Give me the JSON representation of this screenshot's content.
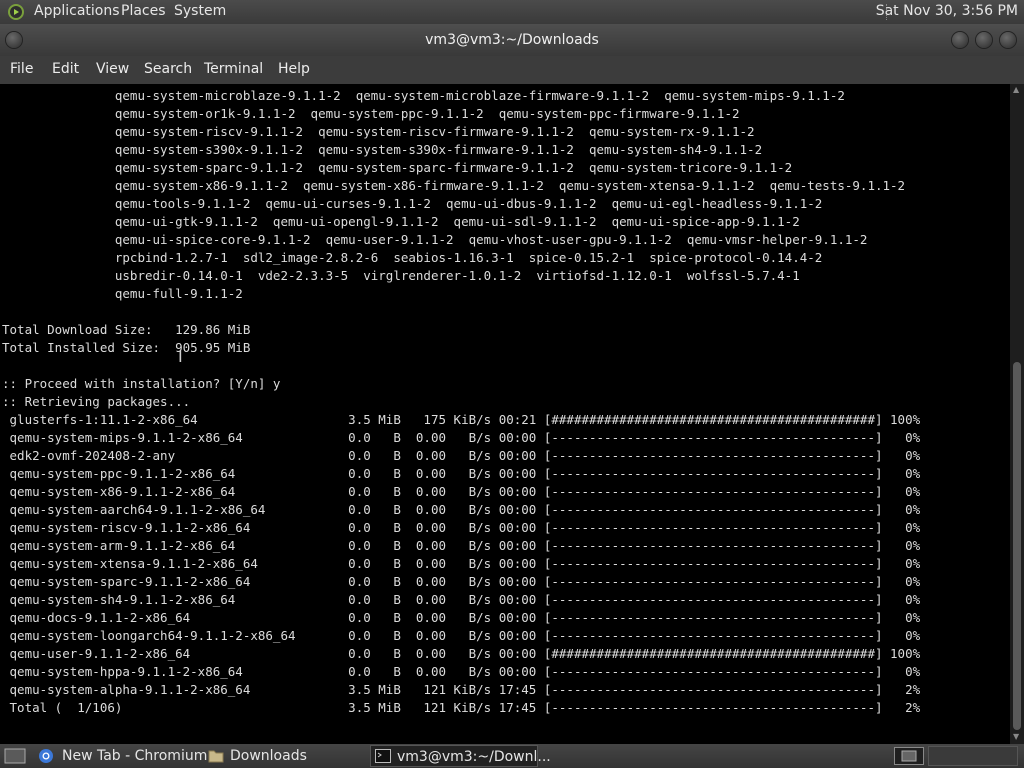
{
  "top_panel": {
    "menus": [
      "Applications",
      "Places",
      "System"
    ],
    "clock": "Sat Nov 30,  3:56 PM"
  },
  "window": {
    "title": "vm3@vm3:~/Downloads",
    "menu": [
      "File",
      "Edit",
      "View",
      "Search",
      "Terminal",
      "Help"
    ]
  },
  "terminal_lines": [
    "               qemu-system-microblaze-9.1.1-2  qemu-system-microblaze-firmware-9.1.1-2  qemu-system-mips-9.1.1-2",
    "               qemu-system-or1k-9.1.1-2  qemu-system-ppc-9.1.1-2  qemu-system-ppc-firmware-9.1.1-2",
    "               qemu-system-riscv-9.1.1-2  qemu-system-riscv-firmware-9.1.1-2  qemu-system-rx-9.1.1-2",
    "               qemu-system-s390x-9.1.1-2  qemu-system-s390x-firmware-9.1.1-2  qemu-system-sh4-9.1.1-2",
    "               qemu-system-sparc-9.1.1-2  qemu-system-sparc-firmware-9.1.1-2  qemu-system-tricore-9.1.1-2",
    "               qemu-system-x86-9.1.1-2  qemu-system-x86-firmware-9.1.1-2  qemu-system-xtensa-9.1.1-2  qemu-tests-9.1.1-2",
    "               qemu-tools-9.1.1-2  qemu-ui-curses-9.1.1-2  qemu-ui-dbus-9.1.1-2  qemu-ui-egl-headless-9.1.1-2",
    "               qemu-ui-gtk-9.1.1-2  qemu-ui-opengl-9.1.1-2  qemu-ui-sdl-9.1.1-2  qemu-ui-spice-app-9.1.1-2",
    "               qemu-ui-spice-core-9.1.1-2  qemu-user-9.1.1-2  qemu-vhost-user-gpu-9.1.1-2  qemu-vmsr-helper-9.1.1-2",
    "               rpcbind-1.2.7-1  sdl2_image-2.8.2-6  seabios-1.16.3-1  spice-0.15.2-1  spice-protocol-0.14.4-2",
    "               usbredir-0.14.0-1  vde2-2.3.3-5  virglrenderer-1.0.1-2  virtiofsd-1.12.0-1  wolfssl-5.7.4-1",
    "               qemu-full-9.1.1-2",
    "",
    "Total Download Size:   129.86 MiB",
    "Total Installed Size:  905.95 MiB",
    "",
    ":: Proceed with installation? [Y/n] y",
    ":: Retrieving packages...",
    " glusterfs-1:11.1-2-x86_64                    3.5 MiB   175 KiB/s 00:21 [###########################################] 100%",
    " qemu-system-mips-9.1.1-2-x86_64              0.0   B  0.00   B/s 00:00 [-------------------------------------------]   0%",
    " edk2-ovmf-202408-2-any                       0.0   B  0.00   B/s 00:00 [-------------------------------------------]   0%",
    " qemu-system-ppc-9.1.1-2-x86_64               0.0   B  0.00   B/s 00:00 [-------------------------------------------]   0%",
    " qemu-system-x86-9.1.1-2-x86_64               0.0   B  0.00   B/s 00:00 [-------------------------------------------]   0%",
    " qemu-system-aarch64-9.1.1-2-x86_64           0.0   B  0.00   B/s 00:00 [-------------------------------------------]   0%",
    " qemu-system-riscv-9.1.1-2-x86_64             0.0   B  0.00   B/s 00:00 [-------------------------------------------]   0%",
    " qemu-system-arm-9.1.1-2-x86_64               0.0   B  0.00   B/s 00:00 [-------------------------------------------]   0%",
    " qemu-system-xtensa-9.1.1-2-x86_64            0.0   B  0.00   B/s 00:00 [-------------------------------------------]   0%",
    " qemu-system-sparc-9.1.1-2-x86_64             0.0   B  0.00   B/s 00:00 [-------------------------------------------]   0%",
    " qemu-system-sh4-9.1.1-2-x86_64               0.0   B  0.00   B/s 00:00 [-------------------------------------------]   0%",
    " qemu-docs-9.1.1-2-x86_64                     0.0   B  0.00   B/s 00:00 [-------------------------------------------]   0%",
    " qemu-system-loongarch64-9.1.1-2-x86_64       0.0   B  0.00   B/s 00:00 [-------------------------------------------]   0%",
    " qemu-user-9.1.1-2-x86_64                     0.0   B  0.00   B/s 00:00 [###########################################] 100%",
    " qemu-system-hppa-9.1.1-2-x86_64              0.0   B  0.00   B/s 00:00 [-------------------------------------------]   0%",
    " qemu-system-alpha-9.1.1-2-x86_64             3.5 MiB   121 KiB/s 17:45 [-------------------------------------------]   2%",
    " Total (  1/106)                              3.5 MiB   121 KiB/s 17:45 [-------------------------------------------]   2%"
  ],
  "taskbar": {
    "tasks": [
      "New Tab - Chromium",
      "Downloads",
      "vm3@vm3:~/Downl..."
    ]
  }
}
